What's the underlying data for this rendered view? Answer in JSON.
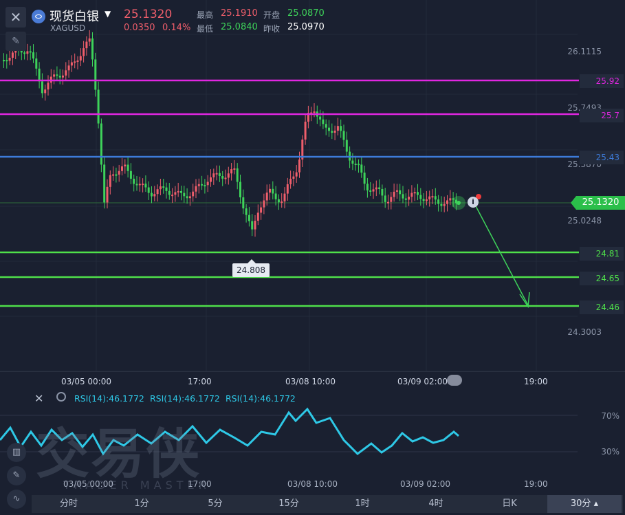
{
  "header": {
    "symbol_name": "现货白银",
    "symbol_code": "XAGUSD",
    "price": "25.1320",
    "change": "0.0350",
    "change_pct": "0.14%",
    "high_label": "最高",
    "high_value": "25.1910",
    "low_label": "最低",
    "low_value": "25.0840",
    "open_label": "开盘",
    "open_value": "25.0870",
    "prev_close_label": "昨收",
    "prev_close_value": "25.0970"
  },
  "colors": {
    "up": "#ef5e6b",
    "down": "#3ed35a",
    "resistance": "#e026e0",
    "pivot": "#3d7bd9",
    "support": "#4fe04a",
    "rsi": "#2ec8e6"
  },
  "y_axis": {
    "ticks": [
      "26.1115",
      "25.7493",
      "25.3870",
      "25.0248",
      "24.3003"
    ]
  },
  "levels": [
    {
      "label": "25.92",
      "kind": "resistance"
    },
    {
      "label": "25.7",
      "kind": "resistance"
    },
    {
      "label": "25.43",
      "kind": "pivot"
    },
    {
      "label": "24.81",
      "kind": "support"
    },
    {
      "label": "24.65",
      "kind": "support"
    },
    {
      "label": "24.46",
      "kind": "support"
    }
  ],
  "current_price_tag": "25.1320",
  "low_marker": "24.808",
  "x_axis": {
    "ticks": [
      "03/05 00:00",
      "17:00",
      "03/08 10:00",
      "03/09 02:00",
      "19:00"
    ]
  },
  "rsi": {
    "labels": [
      "RSI(14):46.1772",
      "RSI(14):46.1772",
      "RSI(14):46.1772"
    ],
    "ticks": [
      "70%",
      "30%"
    ],
    "x_ticks": [
      "03/05 00:00",
      "17:00",
      "03/08 10:00",
      "03/09 02:00",
      "19:00"
    ]
  },
  "watermark": {
    "text": "交易侠",
    "sub": "TRADER MASTER"
  },
  "timeframes": [
    "分时",
    "1分",
    "5分",
    "15分",
    "1时",
    "4时",
    "日K",
    "30分"
  ],
  "active_timeframe": "30分",
  "icons": {
    "close": "close-icon",
    "draw": "pen-icon",
    "candle": "candlestick-icon",
    "pencil": "pencil-icon",
    "indicator": "wave-icon",
    "gear": "gear-icon",
    "info": "info-icon"
  }
}
